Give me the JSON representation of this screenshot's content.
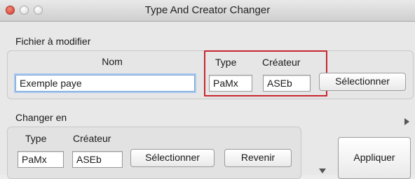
{
  "window": {
    "title": "Type And Creator Changer"
  },
  "file_group": {
    "heading": "Fichier à modifier",
    "name_label": "Nom",
    "name_value": "Exemple paye",
    "type_label": "Type",
    "type_value": "PaMx",
    "creator_label": "Créateur",
    "creator_value": "ASEb",
    "select_button": "Sélectionner"
  },
  "change_group": {
    "heading": "Changer en",
    "type_label": "Type",
    "type_value": "PaMx",
    "creator_label": "Créateur",
    "creator_value": "ASEb",
    "select_button": "Sélectionner",
    "revert_button": "Revenir"
  },
  "apply_button": "Appliquer",
  "icons": {
    "disclosure_right": "triangle-right-icon",
    "disclosure_down": "triangle-down-icon"
  },
  "colors": {
    "highlight": "#c8262d",
    "focus_ring": "#a9c8ee"
  }
}
